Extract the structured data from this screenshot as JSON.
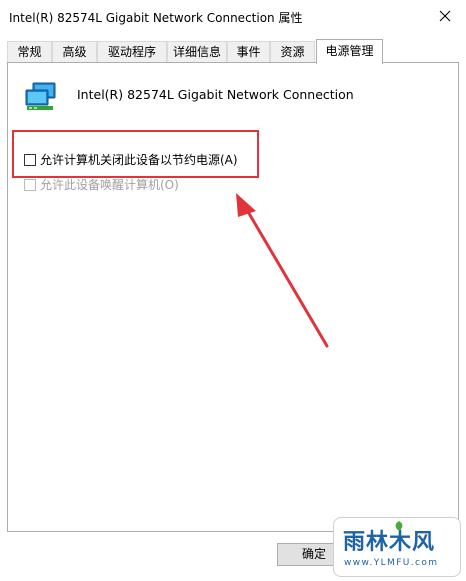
{
  "window": {
    "title": "Intel(R) 82574L Gigabit Network Connection 属性",
    "close_icon": "close-icon"
  },
  "tabs": [
    {
      "label": "常规",
      "active": false
    },
    {
      "label": "高级",
      "active": false
    },
    {
      "label": "驱动程序",
      "active": false
    },
    {
      "label": "详细信息",
      "active": false
    },
    {
      "label": "事件",
      "active": false
    },
    {
      "label": "资源",
      "active": false
    },
    {
      "label": "电源管理",
      "active": true
    }
  ],
  "device": {
    "name": "Intel(R) 82574L Gigabit Network Connection",
    "icon": "network-adapter-icon"
  },
  "options": [
    {
      "label": "允许计算机关闭此设备以节约电源(A)",
      "checked": false,
      "enabled": true
    },
    {
      "label": "允许此设备唤醒计算机(O)",
      "checked": false,
      "enabled": false
    }
  ],
  "annotation": {
    "highlight_color": "#e0343a",
    "arrow_color": "#e0343a"
  },
  "buttons": {
    "ok_label": "确定"
  },
  "watermark": {
    "brand": "雨林木风",
    "url": "www.YLMFU.com",
    "color": "#1d63a8"
  }
}
